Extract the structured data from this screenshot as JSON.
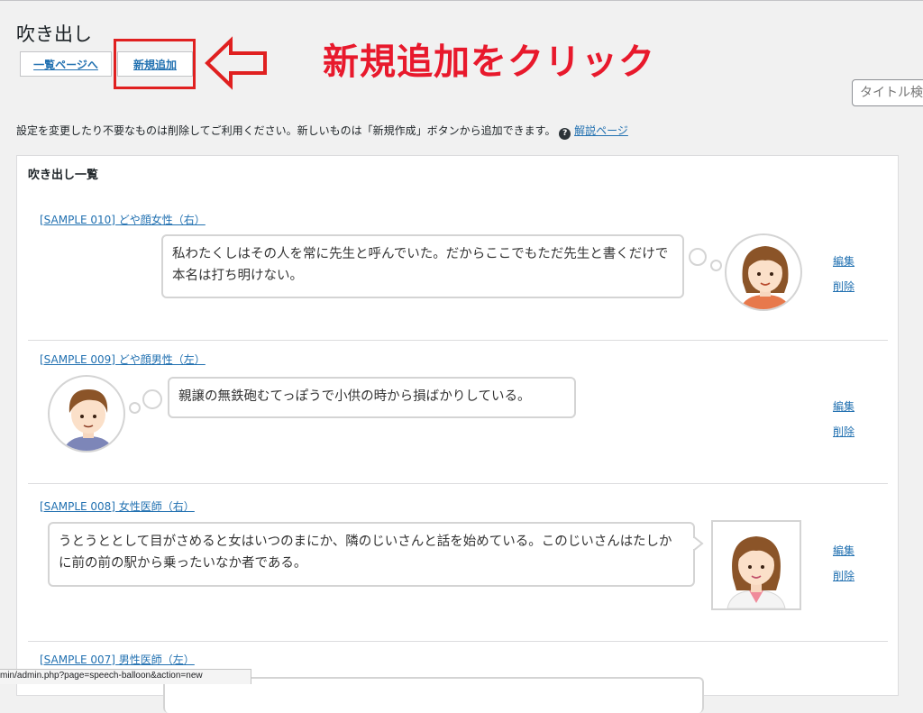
{
  "header": {
    "title": "吹き出し",
    "tabs": [
      {
        "label": "一覧ページへ"
      },
      {
        "label": "新規追加"
      }
    ],
    "annotation": "新規追加をクリック",
    "search_placeholder": "タイトル検索"
  },
  "description": {
    "text": "設定を変更したり不要なものは削除してご利用ください。新しいものは「新規作成」ボタンから追加できます。",
    "help_icon": "?",
    "help_link": "解説ページ"
  },
  "panel": {
    "title": "吹き出し一覧",
    "items": [
      {
        "title": "[SAMPLE 010] どや顔女性（右）",
        "text": "私わたくしはその人を常に先生と呼んでいた。だからここでもただ先生と書くだけで本名は打ち明けない。",
        "edit": "編集",
        "delete": "削除"
      },
      {
        "title": "[SAMPLE 009] どや顔男性（左）",
        "text": "親譲の無鉄砲むてっぽうで小供の時から損ばかりしている。",
        "edit": "編集",
        "delete": "削除"
      },
      {
        "title": "[SAMPLE 008] 女性医師（右）",
        "text": "うとうととして目がさめると女はいつのまにか、隣のじいさんと話を始めている。このじいさんはたしかに前の前の駅から乗ったいなか者である。",
        "edit": "編集",
        "delete": "削除"
      },
      {
        "title": "[SAMPLE 007] 男性医師（左）"
      }
    ]
  },
  "status_bar": {
    "url": "min/admin.php?page=speech-balloon&action=new"
  },
  "colors": {
    "link": "#2271b1",
    "annotation": "#e8192c"
  }
}
